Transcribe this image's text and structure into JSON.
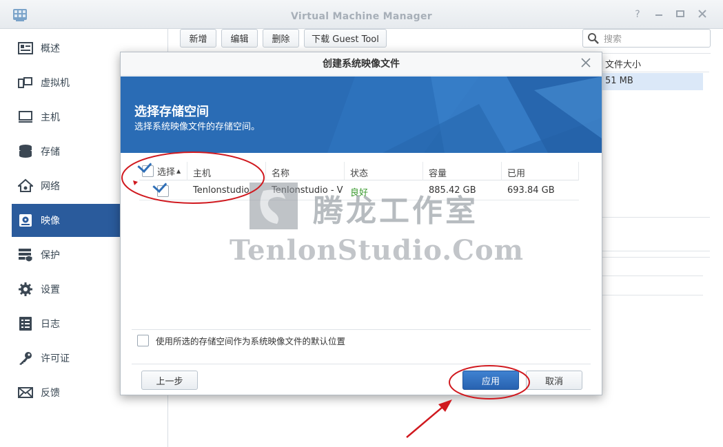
{
  "window": {
    "title": "Virtual Machine Manager"
  },
  "sidebar": {
    "items": [
      {
        "label": "概述",
        "icon": "overview-icon"
      },
      {
        "label": "虚拟机",
        "icon": "vm-icon"
      },
      {
        "label": "主机",
        "icon": "host-icon"
      },
      {
        "label": "存储",
        "icon": "storage-icon"
      },
      {
        "label": "网络",
        "icon": "network-icon"
      },
      {
        "label": "映像",
        "icon": "image-icon",
        "active": true
      },
      {
        "label": "保护",
        "icon": "protect-icon"
      },
      {
        "label": "设置",
        "icon": "settings-icon"
      },
      {
        "label": "日志",
        "icon": "log-icon"
      },
      {
        "label": "许可证",
        "icon": "license-icon"
      },
      {
        "label": "反馈",
        "icon": "feedback-icon"
      }
    ]
  },
  "toolbar": {
    "new_label": "新增",
    "edit_label": "编辑",
    "delete_label": "删除",
    "download_label": "下载 Guest Tool",
    "search_placeholder": "搜索"
  },
  "background_list": {
    "column_header": "文件大小",
    "row_value": "51 MB"
  },
  "modal": {
    "title": "创建系统映像文件",
    "banner_title": "选择存储空间",
    "banner_subtitle": "选择系统映像文件的存储空间。",
    "table": {
      "headers": [
        "选择",
        "主机",
        "名称",
        "状态",
        "容量",
        "已用"
      ],
      "rows": [
        {
          "selected": true,
          "host": "Tenlonstudio",
          "name": "Tenlonstudio - V",
          "status": "良好",
          "capacity": "885.42 GB",
          "used": "693.84 GB"
        }
      ]
    },
    "default_location_label": "使用所选的存储空间作为系统映像文件的默认位置",
    "back_label": "上一步",
    "apply_label": "应用",
    "cancel_label": "取消"
  },
  "watermark": {
    "cn": "腾龙工作室",
    "en": "TenlonStudio.Com"
  },
  "colors": {
    "accent": "#2a5b9c",
    "banner": "#2a6cb5",
    "status_good": "#3a9a2e",
    "annotation_red": "#d0191f"
  }
}
